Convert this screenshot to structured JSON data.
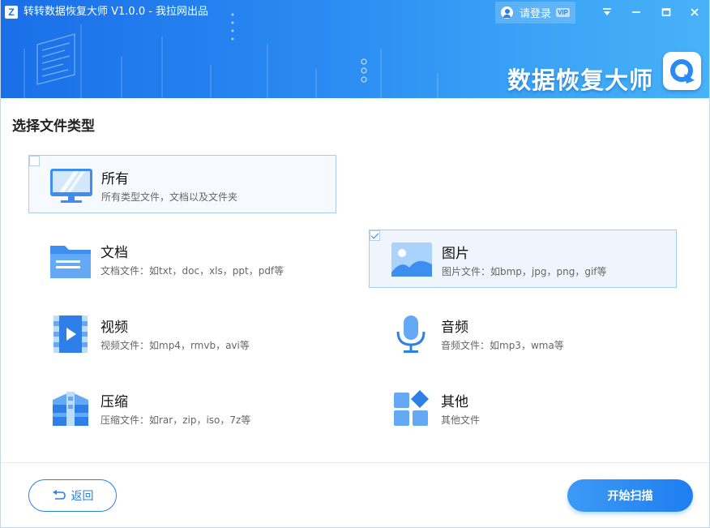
{
  "app": {
    "title": "转转数据恢复大师 V1.0.0 - 我拉网出品",
    "logo_letter": "Z",
    "login_label": "请登录",
    "vip_label": "VIP",
    "brand": "数据恢复大师"
  },
  "page": {
    "section_title": "选择文件类型"
  },
  "file_types": [
    {
      "id": "all",
      "name": "所有",
      "desc": "所有类型文件，文档以及文件夹",
      "icon": "monitor-icon",
      "checked": false
    },
    {
      "id": "doc",
      "name": "文档",
      "desc": "文档文件：如txt，doc，xls，ppt，pdf等",
      "icon": "folder-icon",
      "checked": false
    },
    {
      "id": "image",
      "name": "图片",
      "desc": "图片文件：如bmp，jpg，png，gif等",
      "icon": "image-icon",
      "checked": true
    },
    {
      "id": "video",
      "name": "视频",
      "desc": "视频文件：如mp4，rmvb，avi等",
      "icon": "video-icon",
      "checked": false
    },
    {
      "id": "audio",
      "name": "音频",
      "desc": "音频文件：如mp3，wma等",
      "icon": "microphone-icon",
      "checked": false
    },
    {
      "id": "archive",
      "name": "压缩",
      "desc": "压缩文件：如rar，zip，iso，7z等",
      "icon": "archive-icon",
      "checked": false
    },
    {
      "id": "other",
      "name": "其他",
      "desc": "其他文件",
      "icon": "grid-icon",
      "checked": false
    }
  ],
  "footer": {
    "back_label": "返回",
    "scan_label": "开始扫描"
  },
  "colors": {
    "accent": "#2a7fe9",
    "header_start": "#1a6fe8",
    "header_end": "#47b2f8"
  }
}
